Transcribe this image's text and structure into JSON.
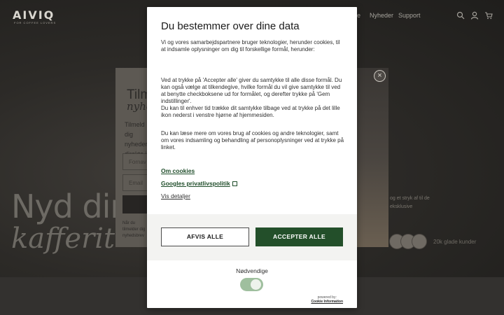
{
  "background": {
    "logo": "AIVIQ",
    "logo_sub": "FOR COFFEE LOVERS",
    "nav_fragment": "e",
    "nav": {
      "news": "Nyheder",
      "support": "Support"
    },
    "icons": {
      "search": "search-icon",
      "account": "user-icon",
      "cart": "cart-icon"
    },
    "hero": {
      "line1": "Nyd din",
      "line2": "kafferit"
    },
    "newsletter": {
      "title_line1": "Tilm",
      "title_line2": "nyhe",
      "body": "Tilmeld dig nyheder direkte i",
      "field1_placeholder": "Fornav",
      "field2_placeholder": "Email",
      "fine_print": "Når du tilmelder dig nyhedsbrev",
      "close_label": "×"
    },
    "side_text": "og et stryk af til de eksklusive",
    "avatars_text": "20k glade kunder"
  },
  "cookie_dialog": {
    "title": "Du bestemmer over dine data",
    "p1": "Vi og vores samarbejdspartnere bruger teknologier, herunder cookies, til at indsamle oplysninger om dig til forskellige formål, herunder:",
    "p2a": "Ved at trykke på 'Accepter alle' giver du samtykke til alle disse formål. Du kan også vælge at tilkendegive, hvilke formål du vil give samtykke til ved at benytte checkboksene ud for formålet, og derefter trykke på 'Gem indstillinger'.",
    "p2b": "Du kan til enhver tid trække dit samtykke tilbage ved at trykke på det lille ikon nederst i venstre hjørne af hjemmesiden.",
    "p3": "Du kan læse mere om vores brug af cookies og andre teknologier, samt om vores indsamling og behandling af personoplysninger ved at trykke på linket.",
    "link_cookies": "Om cookies",
    "link_google": "Googles privatlivspolitik",
    "link_details": "Vis detaljer",
    "btn_reject": "AFVIS ALLE",
    "btn_accept": "ACCEPTER ALLE",
    "necessary_label": "Nødvendige",
    "necessary_enabled": true,
    "powered_by": "powered by:",
    "powered_brand": "Cookie Information",
    "colors": {
      "accent": "#234f2a",
      "toggle_on": "#9fbf9e"
    }
  }
}
